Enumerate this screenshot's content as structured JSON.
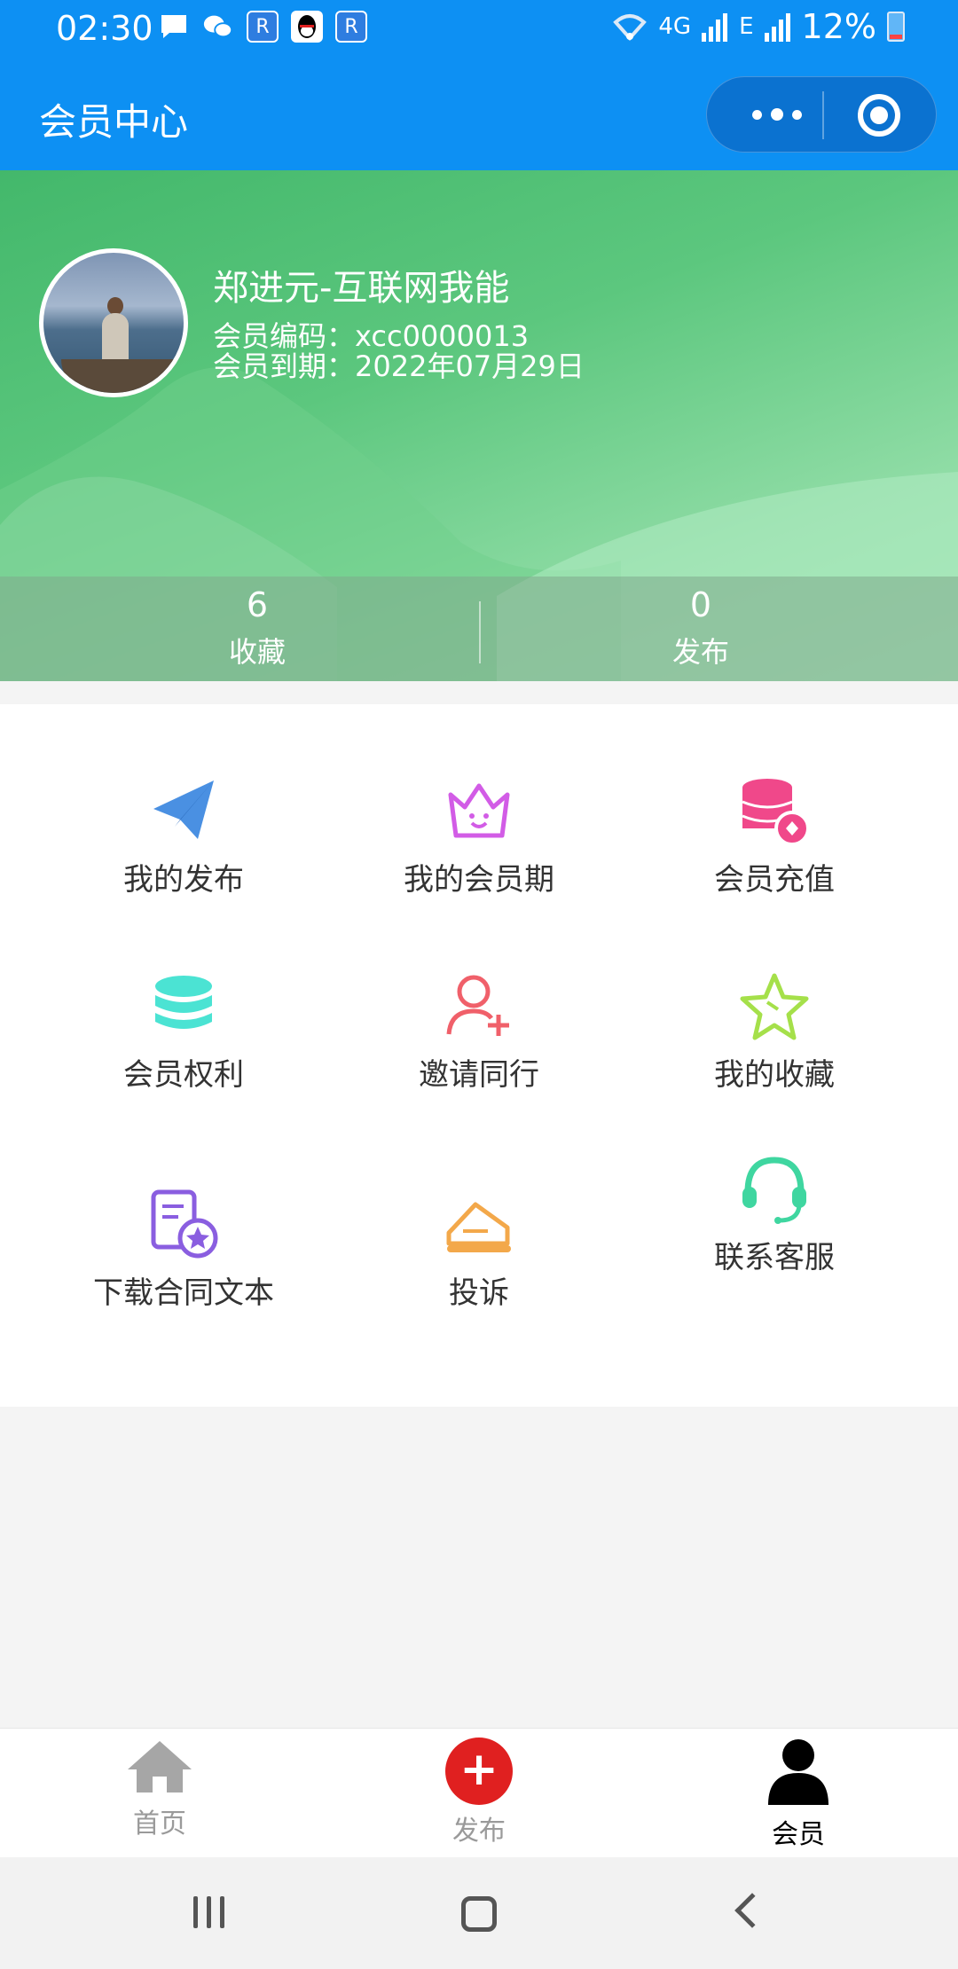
{
  "status_bar": {
    "time": "02:30",
    "network": "4G",
    "network2": "E",
    "battery": "12%",
    "icons": [
      "message-icon",
      "wechat-icon",
      "app-r-icon",
      "qq-icon",
      "app-r-icon"
    ]
  },
  "header": {
    "title": "会员中心"
  },
  "profile": {
    "name": "郑进元-互联网我能",
    "code": "会员编码：xcc0000013",
    "expire": "会员到期：2022年07月29日"
  },
  "stats": [
    {
      "value": "6",
      "label": "收藏"
    },
    {
      "value": "0",
      "label": "发布"
    }
  ],
  "menu": [
    {
      "label": "我的发布",
      "icon": "paper-plane-icon",
      "color": "#4a90e2"
    },
    {
      "label": "我的会员期",
      "icon": "crown-icon",
      "color": "#d25ce6"
    },
    {
      "label": "会员充值",
      "icon": "coin-stack-icon",
      "color": "#f0488a"
    },
    {
      "label": "会员权利",
      "icon": "database-icon",
      "color": "#4be3d3"
    },
    {
      "label": "邀请同行",
      "icon": "add-user-icon",
      "color": "#f0606a"
    },
    {
      "label": "我的收藏",
      "icon": "star-icon",
      "color": "#a5e04a"
    },
    {
      "label": "下载合同文本",
      "icon": "contract-icon",
      "color": "#8a5ee0"
    },
    {
      "label": "投诉",
      "icon": "envelope-icon",
      "color": "#f3a84a"
    },
    {
      "label": "联系客服",
      "icon": "headset-icon",
      "color": "#3fd6a0"
    }
  ],
  "tabbar": {
    "home": "首页",
    "publish": "发布",
    "member": "会员"
  }
}
